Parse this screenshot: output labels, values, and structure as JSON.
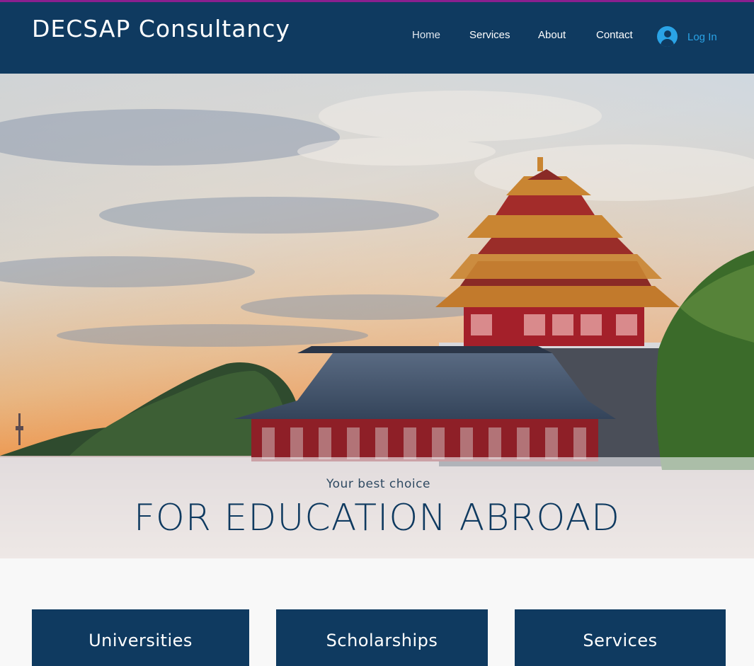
{
  "header": {
    "site_title": "DECSAP Consultancy",
    "nav": [
      {
        "label": "Home"
      },
      {
        "label": "Services"
      },
      {
        "label": "About"
      },
      {
        "label": "Contact"
      }
    ],
    "login": {
      "label": "Log In",
      "icon": "user-avatar-icon"
    }
  },
  "hero": {
    "tagline": "Your best choice",
    "headline": "FOR EDUCATION ABROAD"
  },
  "cards": [
    {
      "label": "Universities"
    },
    {
      "label": "Scholarships"
    },
    {
      "label": "Services"
    }
  ],
  "colors": {
    "header_bg": "#0f3a60",
    "accent_line": "#8a1f8f",
    "login_blue": "#2aa3e6"
  }
}
